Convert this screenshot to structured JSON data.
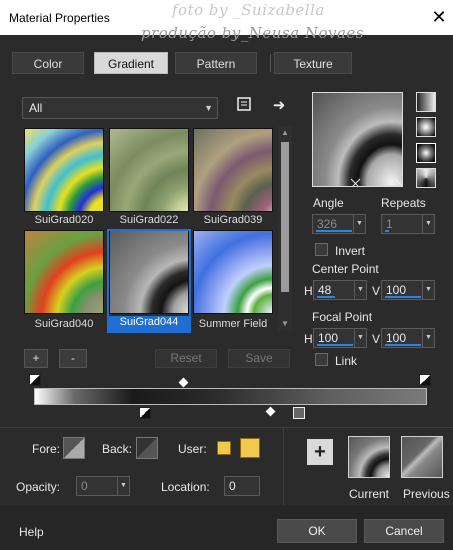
{
  "window": {
    "title": "Material Properties",
    "watermark_line1": "foto by _Suizabella",
    "watermark_line2": "produção by_Neusa Novaes"
  },
  "tabs": [
    {
      "label": "Color"
    },
    {
      "label": "Gradient"
    },
    {
      "label": "Pattern"
    },
    {
      "label": "Texture"
    }
  ],
  "presets": {
    "combo_value": "All",
    "items": [
      {
        "label": "SuiGrad020"
      },
      {
        "label": "SuiGrad022"
      },
      {
        "label": "SuiGrad039"
      },
      {
        "label": "SuiGrad040"
      },
      {
        "label": "SuiGrad044"
      },
      {
        "label": "Summer Field"
      }
    ],
    "add_label": "+",
    "remove_label": "-",
    "reset_label": "Reset",
    "save_label": "Save"
  },
  "settings": {
    "angle_label": "Angle",
    "angle_value": "326",
    "repeats_label": "Repeats",
    "repeats_value": "1",
    "invert_label": "Invert",
    "center_label": "Center Point",
    "center_h": "48",
    "center_v": "100",
    "focal_label": "Focal Point",
    "focal_h": "100",
    "focal_v": "100",
    "link_label": "Link",
    "h": "H",
    "v": "V"
  },
  "editor": {
    "fore_label": "Fore:",
    "back_label": "Back:",
    "user_label": "User:",
    "opacity_label": "Opacity:",
    "opacity_value": "0",
    "location_label": "Location:",
    "location_value": "0"
  },
  "previews": {
    "current_label": "Current",
    "previous_label": "Previous"
  },
  "footer": {
    "help_label": "Help",
    "ok_label": "OK",
    "cancel_label": "Cancel"
  },
  "colors": {
    "accent": "#1e6fd1",
    "user_color": "#f2c94c"
  }
}
